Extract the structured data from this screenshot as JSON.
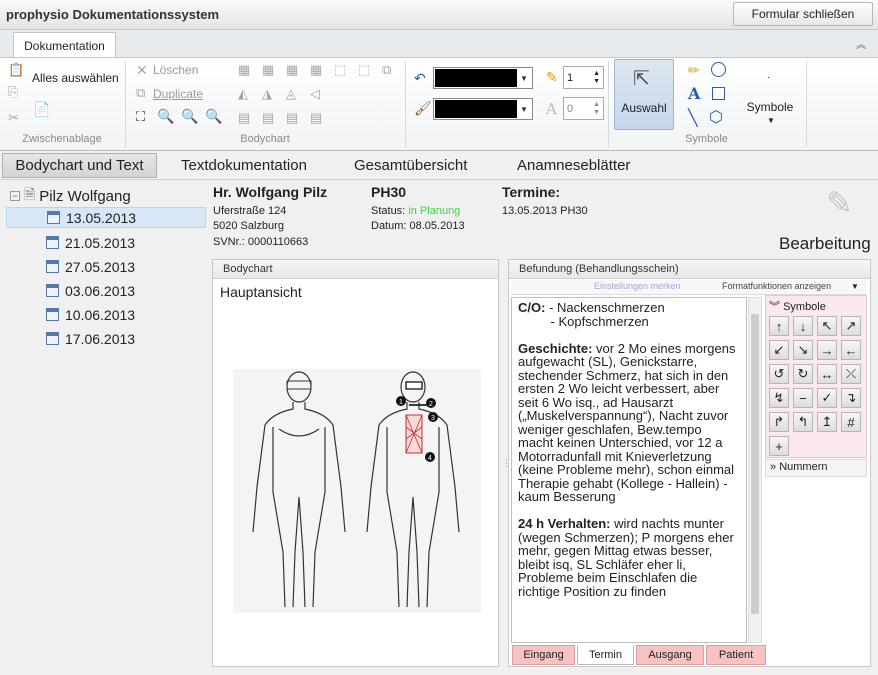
{
  "app": {
    "title": "prophysio Dokumentationssystem",
    "close_form": "Formular schließen"
  },
  "ribbon": {
    "tab": "Dokumentation",
    "clipboard": {
      "select_all": "Alles auswählen",
      "group": "Zwischenablage"
    },
    "bodychart": {
      "delete": "Löschen",
      "duplicate": "Duplicate",
      "group": "Bodychart"
    },
    "format": {
      "line_width": "1",
      "opacity": "0",
      "text_glyph": "A"
    },
    "tools": {
      "select": "Auswahl",
      "symbols": "Symbole",
      "group": "Symbole",
      "text_glyph": "A"
    }
  },
  "subtabs": [
    "Bodychart und Text",
    "Textdokumentation",
    "Gesamtübersicht",
    "Anamneseblätter"
  ],
  "tree": {
    "patient": "Pilz Wolfgang",
    "dates": [
      "13.05.2013",
      "21.05.2013",
      "27.05.2013",
      "03.06.2013",
      "10.06.2013",
      "17.06.2013"
    ]
  },
  "patient": {
    "name": "Hr. Wolfgang Pilz",
    "street": "Uferstraße 124",
    "city": "5020 Salzburg",
    "svnr": "SVNr.: 0000110663",
    "code": "PH30",
    "status_label": "Status:",
    "status_value": "in Planung",
    "date": "Datum: 08.05.2013",
    "termine_label": "Termine:",
    "termine_value": "13.05.2013 PH30",
    "edit_label": "Bearbeitung"
  },
  "bodychart": {
    "header": "Bodychart",
    "view": "Hauptansicht",
    "markers": [
      "1",
      "2",
      "3",
      "4"
    ]
  },
  "befund": {
    "header": "Befundung (Behandlungsschein)",
    "save_settings": "Einstellungen merken",
    "format_functions": "Formatfunktionen anzeigen",
    "co_label": "C/O:",
    "co_lines": [
      "- Nackenschmerzen",
      "- Kopfschmerzen"
    ],
    "history_label": "Geschichte:",
    "history_text": " vor 2 Mo eines morgens aufgewacht (SL), Genickstarre, stechender Schmerz, hat sich in den ersten 2 Wo leicht verbessert, aber seit 6 Wo isq., ad Hausarzt („Muskelverspannung“), Nacht zuvor weniger geschlafen, Bew.tempo macht keinen Unterschied, vor 12 a Motorradunfall mit Knieverletzung (keine Probleme mehr), schon einmal Therapie gehabt (Kollege - Hallein) - kaum Besserung",
    "behavior_label": "24 h Verhalten:",
    "behavior_text": " wird nachts munter (wegen Schmerzen); P morgens eher mehr, gegen Mittag etwas besser, bleibt isq, SL Schläfer eher li, Probleme beim Einschlafen die richtige Position zu finden",
    "symbols_title": "Symbole",
    "numbers_title": "Nummern",
    "tabs": [
      "Eingang",
      "Termin",
      "Ausgang",
      "Patient"
    ],
    "symbol_glyphs": [
      "↑",
      "↓",
      "↖",
      "↗",
      "↙",
      "↘",
      "→",
      "←",
      "↺",
      "↻",
      "↔",
      "⤫",
      "↯",
      "−",
      "✓",
      "↴",
      "↱",
      "↰",
      "↥",
      "#",
      "+"
    ]
  },
  "colors": {
    "status": "#3dd63d",
    "tab_pink": "#f7c2c2",
    "selection": "#d8e7f7"
  }
}
